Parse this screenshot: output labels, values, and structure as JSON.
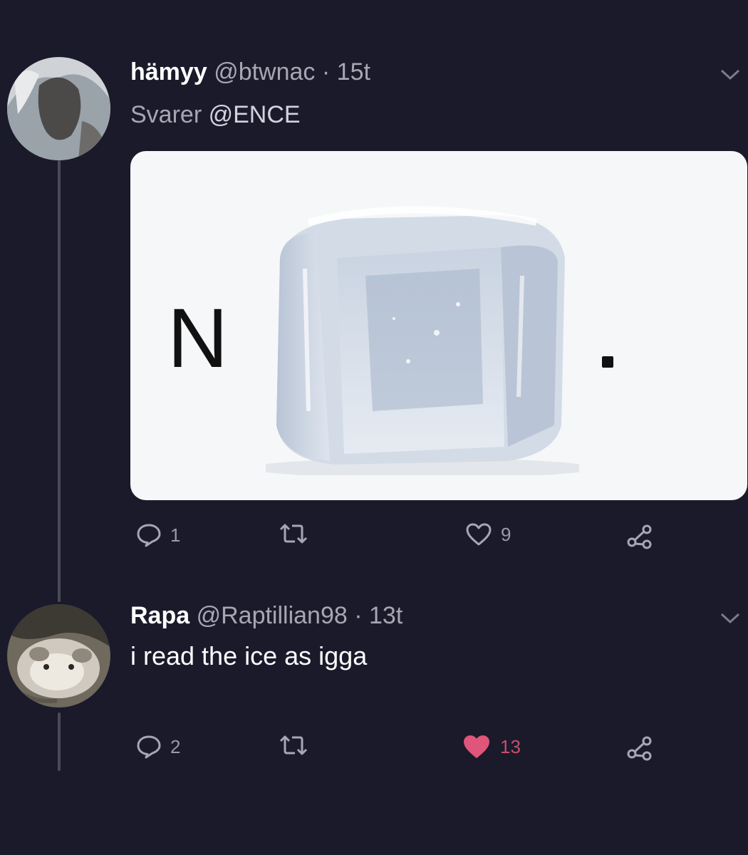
{
  "colors": {
    "background": "#1b1a2b",
    "muted_text": "#a6a7b2",
    "like_active": "#e0557a"
  },
  "tweets": [
    {
      "display_name": "hämyy",
      "handle": "@btwnac",
      "separator": "·",
      "time": "15t",
      "reply_label": "Svarer",
      "reply_mention": "@ENCE",
      "media": {
        "letter": "N",
        "dot": "."
      },
      "actions": {
        "replies": "1",
        "retweets": "",
        "likes": "9",
        "liked": false
      }
    },
    {
      "display_name": "Rapa",
      "handle": "@Raptillian98",
      "separator": "·",
      "time": "13t",
      "text": "i read the ice as igga",
      "actions": {
        "replies": "2",
        "retweets": "",
        "likes": "13",
        "liked": true
      }
    }
  ],
  "icons": [
    "chevron-down-icon",
    "reply-icon",
    "retweet-icon",
    "heart-icon",
    "share-icon"
  ]
}
